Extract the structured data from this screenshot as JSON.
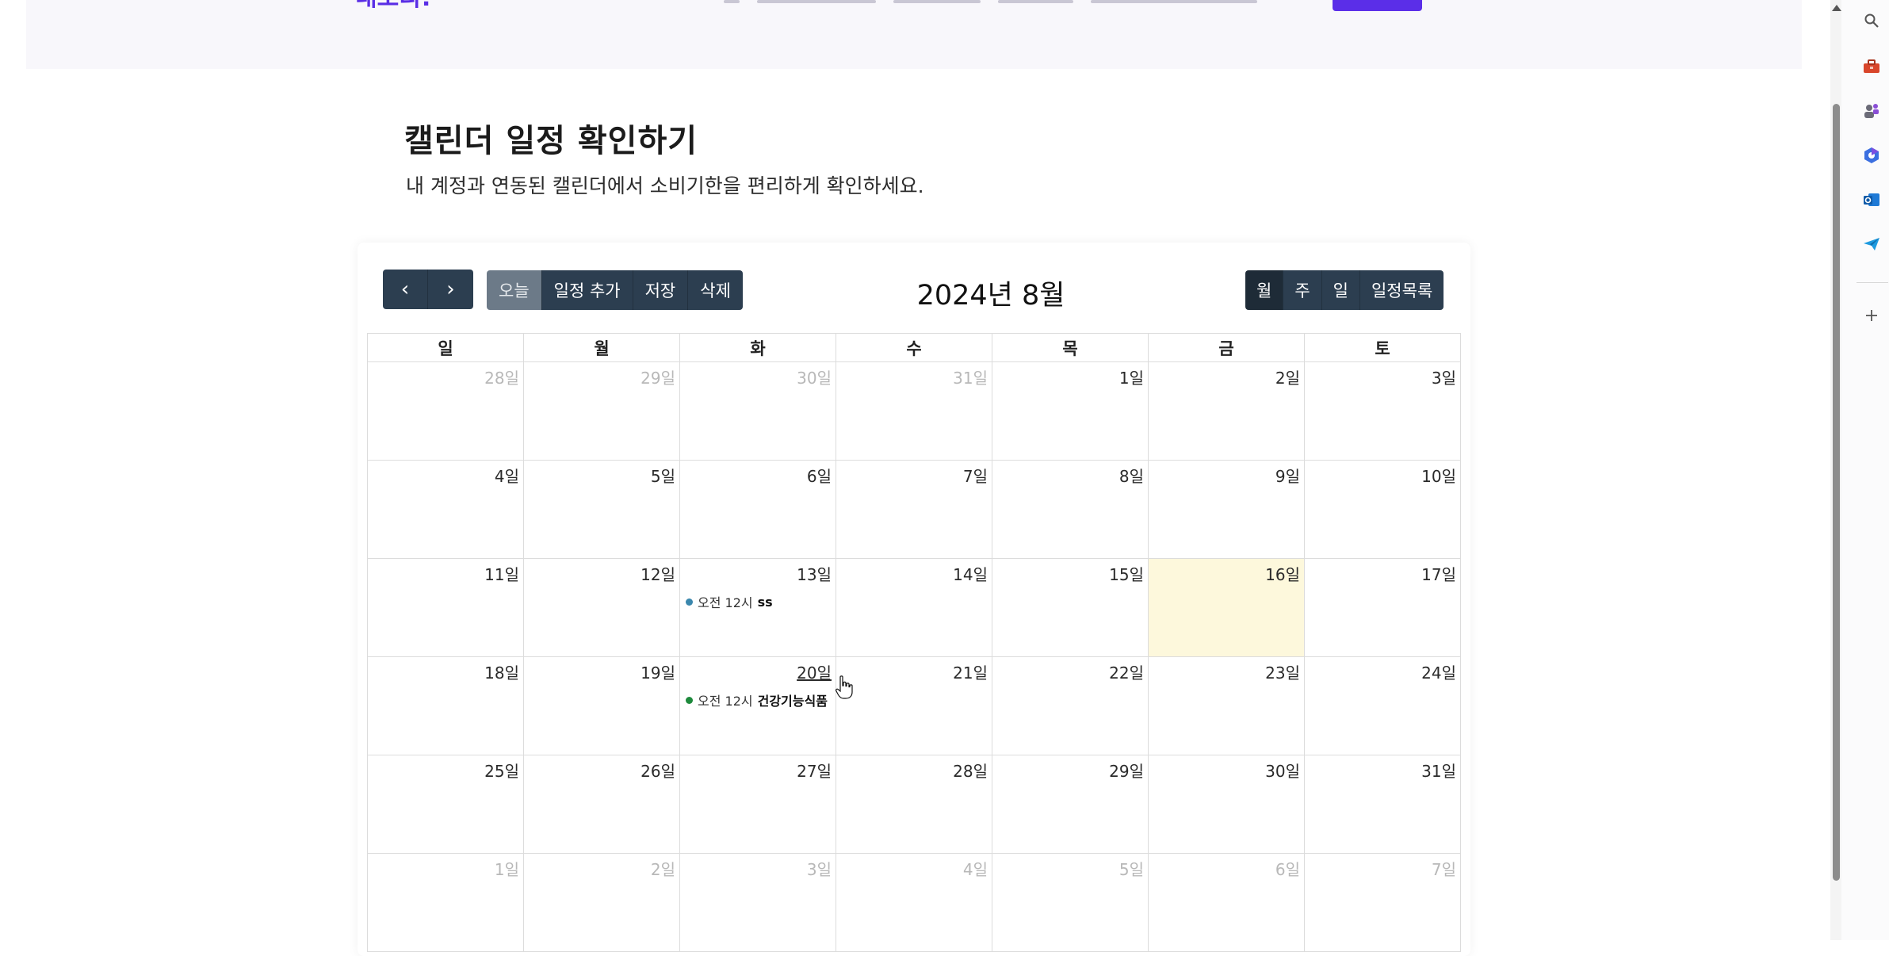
{
  "header": {
    "logo_text": "내조리!",
    "nav_items_count_hint": ""
  },
  "page": {
    "title": "캘린더 일정 확인하기",
    "subtitle": "내 계정과 연동된 캘린더에서 소비기한을 편리하게 확인하세요."
  },
  "toolbar": {
    "prev_label": "‹",
    "next_label": "›",
    "today_label": "오늘",
    "add_label": "일정 추가",
    "save_label": "저장",
    "delete_label": "삭제",
    "title": "2024년 8월",
    "view_month_label": "월",
    "view_week_label": "주",
    "view_day_label": "일",
    "view_list_label": "일정목록"
  },
  "calendar": {
    "weekdays": [
      "일",
      "월",
      "화",
      "수",
      "목",
      "금",
      "토"
    ],
    "today": "16일",
    "weeks": [
      [
        "28일",
        "29일",
        "30일",
        "31일",
        "1일",
        "2일",
        "3일"
      ],
      [
        "4일",
        "5일",
        "6일",
        "7일",
        "8일",
        "9일",
        "10일"
      ],
      [
        "11일",
        "12일",
        "13일",
        "14일",
        "15일",
        "16일",
        "17일"
      ],
      [
        "18일",
        "19일",
        "20일",
        "21일",
        "22일",
        "23일",
        "24일"
      ],
      [
        "25일",
        "26일",
        "27일",
        "28일",
        "29일",
        "30일",
        "31일"
      ],
      [
        "1일",
        "2일",
        "3일",
        "4일",
        "5일",
        "6일",
        "7일"
      ]
    ],
    "events": [
      {
        "date": "13일",
        "time": "오전 12시",
        "title": "ss",
        "color": "#3a87ad"
      },
      {
        "date": "20일",
        "time": "오전 12시",
        "title": "건강기능식품",
        "color": "#1e8a3c"
      }
    ]
  },
  "colors": {
    "accent": "#5b2ee8",
    "toolbar": "#2c3e50",
    "today_bg": "#fdf8dc"
  },
  "right_rail": {
    "icons": [
      "search-icon",
      "toolbox-icon",
      "people-icon",
      "copilot-icon",
      "outlook-icon",
      "send-icon",
      "plus-icon"
    ]
  }
}
